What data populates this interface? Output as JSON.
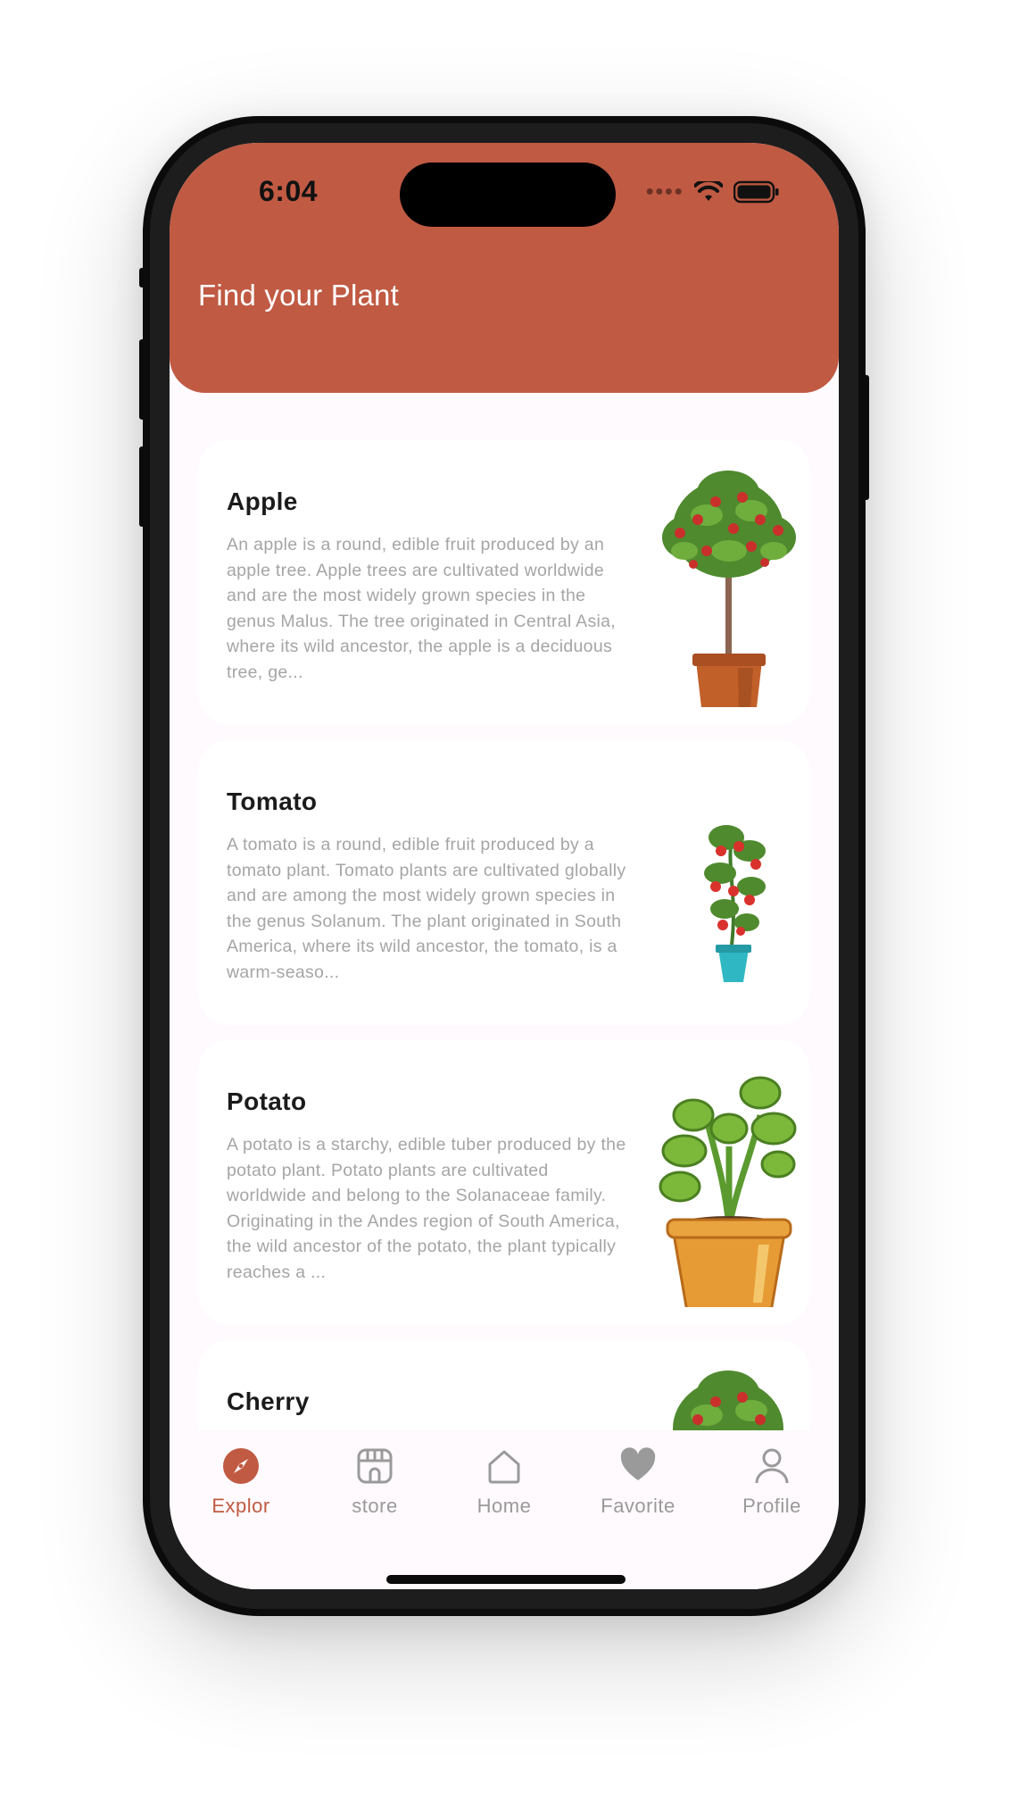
{
  "status_bar": {
    "time": "6:04"
  },
  "header": {
    "title": "Find your Plant",
    "color": "#c05a43"
  },
  "plants": [
    {
      "name": "Apple",
      "description": "An apple is a round, edible fruit produced by an apple tree. Apple trees are cultivated worldwide and are the most widely grown species in the genus Malus. The tree originated in Central Asia, where its wild ancestor, the apple is a deciduous tree, ge...",
      "image": "apple-tree-in-pot"
    },
    {
      "name": "Tomato",
      "description": "A tomato is a round, edible fruit produced by a tomato plant. Tomato plants are cultivated globally and are among the most widely grown species in the genus Solanum. The plant originated in South America, where its wild ancestor, the tomato, is a warm-seaso...",
      "image": "tomato-plant-in-pot"
    },
    {
      "name": "Potato",
      "description": "A potato is a starchy, edible tuber produced by the potato plant. Potato plants are cultivated worldwide and belong to the Solanaceae family. Originating in the Andes region of South America, the wild ancestor of the potato, the plant typically reaches a ...",
      "image": "potato-plant-in-pot"
    },
    {
      "name": "Cherry",
      "description": "",
      "image": "cherry-tree-in-pot"
    }
  ],
  "tabs": [
    {
      "label": "Explor",
      "icon": "compass-icon",
      "active": true
    },
    {
      "label": "store",
      "icon": "store-icon",
      "active": false
    },
    {
      "label": "Home",
      "icon": "home-icon",
      "active": false
    },
    {
      "label": "Favorite",
      "icon": "heart-icon",
      "active": false
    },
    {
      "label": "Profile",
      "icon": "person-icon",
      "active": false
    }
  ]
}
